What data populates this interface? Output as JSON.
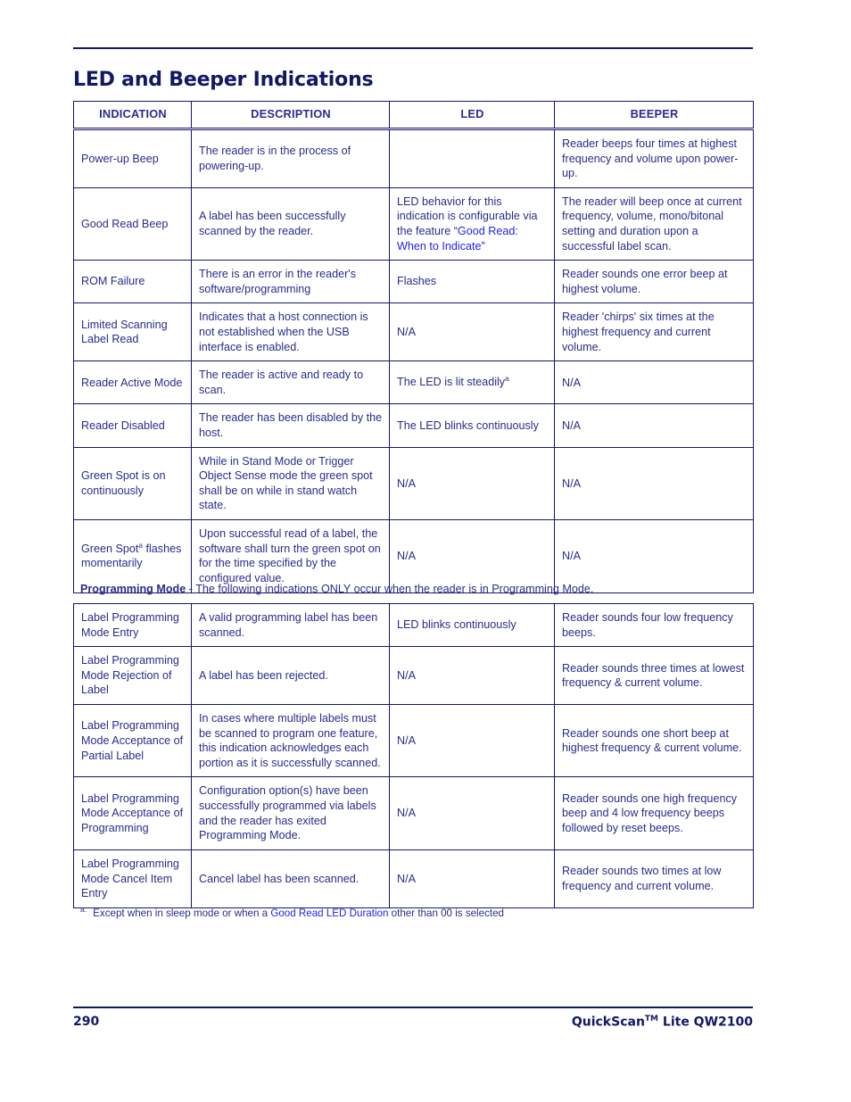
{
  "document": {
    "title": "LED and Beeper Indications",
    "footer": {
      "page_number": "290",
      "product_name": "QuickScan",
      "product_tm": "TM",
      "product_suffix": " Lite QW2100"
    },
    "footnote": {
      "marker": "a.",
      "text_before": "Except when in sleep mode or when a ",
      "link_text": "Good Read LED Duration",
      "text_after": " other than 00 is selected"
    }
  },
  "main_table": {
    "headers": [
      "INDICATION",
      "DESCRIPTION",
      "LED",
      "BEEPER"
    ],
    "rows": [
      {
        "indication": "Power-up Beep",
        "description": "The reader is in the process of powering-up.",
        "led": "",
        "beeper": "Reader beeps four times at highest frequency and volume upon power-up.",
        "led_align": "left",
        "beeper_align": "left"
      },
      {
        "indication": "Good Read Beep",
        "description": "A label has been successfully scanned by the reader.",
        "led_prefix": "LED behavior for this indication is configurable via the feature “",
        "led_link": "Good Read: When to Indicate",
        "led_suffix": "”",
        "beeper": "The reader will beep once at current frequency, volume, mono/bitonal setting and duration upon a successful label scan.",
        "led_align": "left",
        "beeper_align": "left"
      },
      {
        "indication": "ROM Failure",
        "description": "There is an error in the reader's software/programming",
        "led": "Flashes",
        "beeper": "Reader sounds one error beep at highest volume.",
        "led_align": "center",
        "beeper_align": "left"
      },
      {
        "indication": "Limited Scanning Label Read",
        "description": "Indicates that a host connection is not established when the USB interface is enabled.",
        "led": "N/A",
        "beeper": "Reader 'chirps' six times at the highest frequency and current volume.",
        "led_align": "center",
        "beeper_align": "left"
      },
      {
        "indication": "Reader Active Mode",
        "description": "The reader is active and ready to scan.",
        "led_text": "The LED is lit steadily",
        "led_sup": "a",
        "beeper": "N/A",
        "led_align": "center",
        "beeper_align": "center"
      },
      {
        "indication": "Reader Disabled",
        "description": "The reader has been disabled by the host.",
        "led": "The LED blinks continuously",
        "beeper": "N/A",
        "led_align": "left",
        "beeper_align": "center"
      },
      {
        "indication": "Green Spot is on continuously",
        "description": "While in Stand Mode or Trigger Object Sense mode the green spot shall be on while in stand watch state.",
        "led": "N/A",
        "beeper": "N/A",
        "led_align": "center",
        "beeper_align": "center"
      },
      {
        "indication_text": "Green Spot",
        "indication_sup": "a",
        "indication_rest": " flashes momentarily",
        "description": "Upon successful read of a label, the software shall turn the green spot on for the time specified by the configured value.",
        "led": "N/A",
        "beeper": "N/A",
        "led_align": "center",
        "beeper_align": "center"
      }
    ]
  },
  "programming_note": {
    "bold": "Programming Mode",
    "rest": " - The following indications ONLY occur when the reader is in Programming Mode."
  },
  "programming_table": {
    "rows": [
      {
        "indication": "Label Programming Mode Entry",
        "description": "A valid programming label has been scanned.",
        "led": "LED blinks continuously",
        "beeper": "Reader sounds four low frequency beeps.",
        "led_align": "center",
        "beeper_align": "center"
      },
      {
        "indication": "Label Programming Mode Rejection of Label",
        "description": "A label has been rejected.",
        "led": "N/A",
        "beeper": "Reader sounds three times at lowest frequency & current volume.",
        "led_align": "center",
        "beeper_align": "left"
      },
      {
        "indication": "Label Programming Mode Acceptance of Partial Label",
        "description": "In cases where multiple labels must be scanned to program one feature, this indication acknowledges each portion as it is successfully scanned.",
        "led": "N/A",
        "beeper": "Reader sounds one short beep at highest frequency & current volume.",
        "led_align": "center",
        "beeper_align": "center"
      },
      {
        "indication": "Label Programming Mode Acceptance of Programming",
        "description": "Configuration option(s) have been successfully programmed via labels and the reader has exited Programming Mode.",
        "led": "N/A",
        "beeper": "Reader sounds  one high frequency beep and 4 low frequency beeps followed by reset beeps.",
        "led_align": "center",
        "beeper_align": "left"
      },
      {
        "indication": "Label Programming Mode Cancel Item Entry",
        "description": "Cancel label has been scanned.",
        "led": "N/A",
        "beeper": "Reader sounds two times at low frequency and current volume.",
        "led_align": "center",
        "beeper_align": "left"
      }
    ]
  },
  "colors": {
    "title": "#111866",
    "body_text": "#2b2b8c",
    "link": "#2222ee",
    "rule": "#111866"
  }
}
